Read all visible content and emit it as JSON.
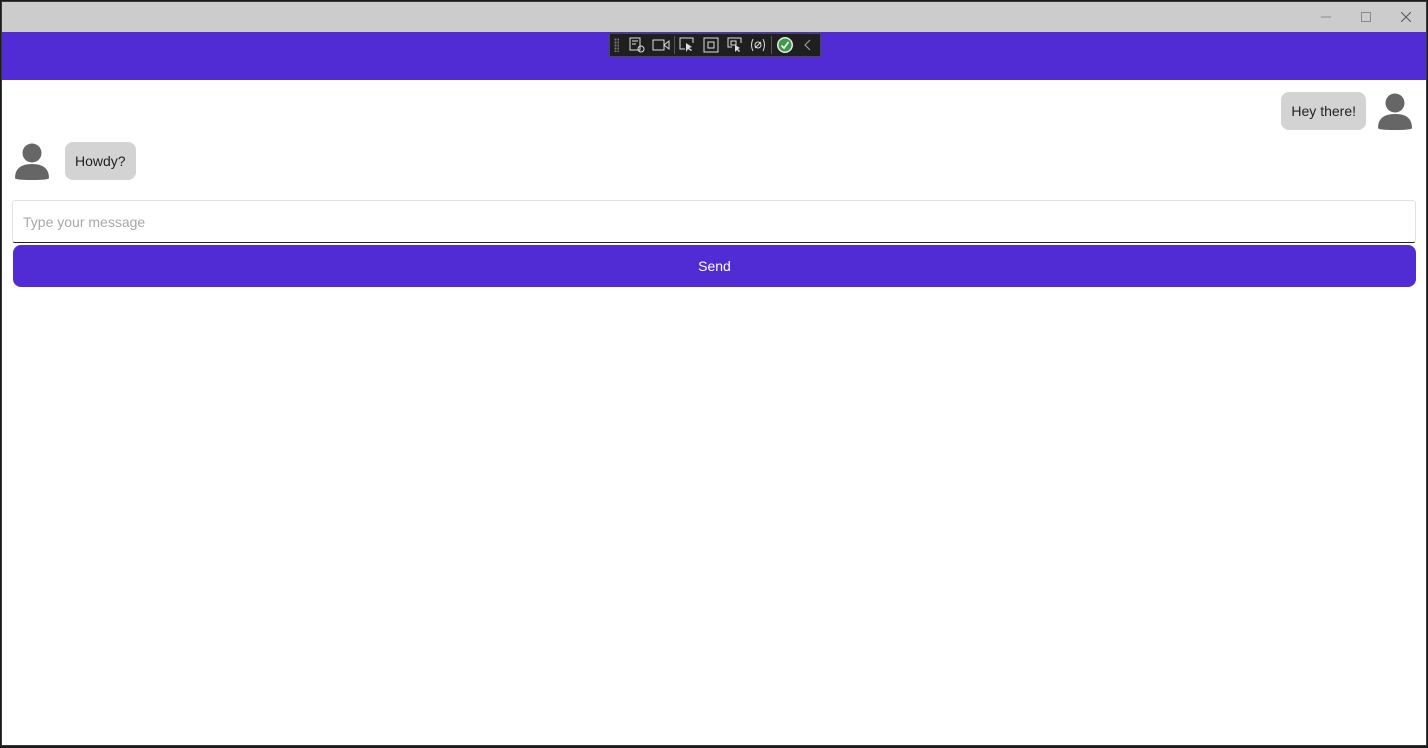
{
  "window": {
    "controls": {
      "minimize": "minimize-icon",
      "maximize": "maximize-icon",
      "close": "close-icon"
    },
    "titlebar_color": "#cccccc"
  },
  "appbar": {
    "color": "#512bd4",
    "debug_toolbar": {
      "icons": [
        "live-visual-tree-icon",
        "record-icon",
        "select-element-icon",
        "display-layout-adorners-icon",
        "track-focus-icon",
        "binding-failures-icon",
        "hot-reload-status-icon",
        "collapse-chevron-icon"
      ]
    }
  },
  "messages": [
    {
      "side": "right",
      "text": "Hey there!",
      "avatar": "user-avatar-icon"
    },
    {
      "side": "left",
      "text": "Howdy?",
      "avatar": "user-avatar-icon"
    }
  ],
  "composer": {
    "placeholder": "Type your message",
    "value": "",
    "send_label": "Send",
    "accent_color": "#512bd4"
  }
}
